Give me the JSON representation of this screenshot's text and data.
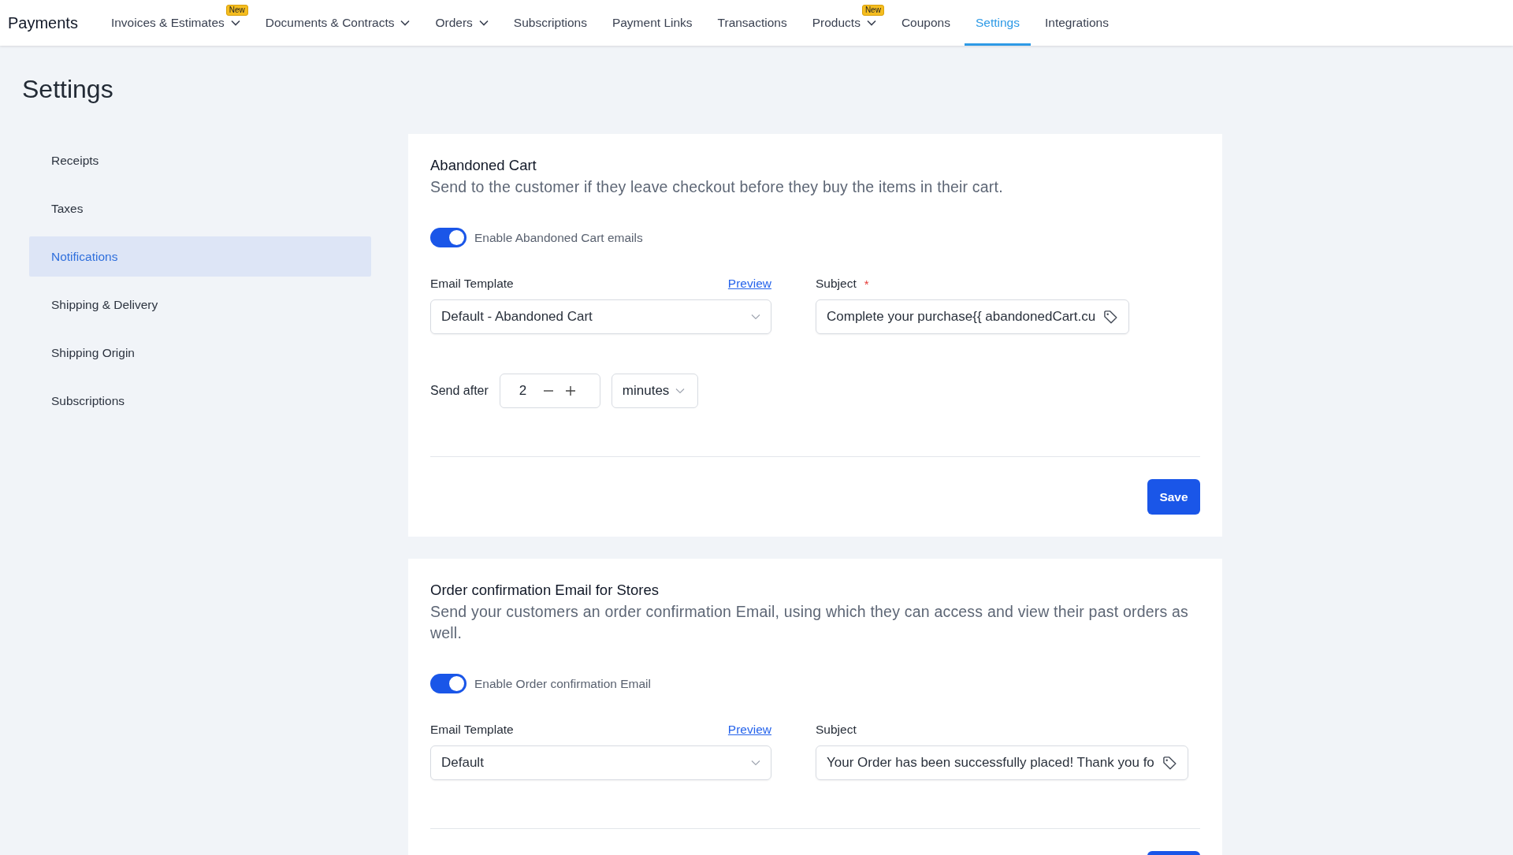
{
  "app_title": "Payments",
  "nav": [
    {
      "label": "Invoices & Estimates",
      "selected": false,
      "dropdown": true,
      "badge": "New"
    },
    {
      "label": "Documents & Contracts",
      "selected": false,
      "dropdown": true
    },
    {
      "label": "Orders",
      "selected": false,
      "dropdown": true
    },
    {
      "label": "Subscriptions",
      "selected": false,
      "dropdown": false
    },
    {
      "label": "Payment Links",
      "selected": false,
      "dropdown": false
    },
    {
      "label": "Transactions",
      "selected": false,
      "dropdown": false
    },
    {
      "label": "Products",
      "selected": false,
      "dropdown": true,
      "badge": "New"
    },
    {
      "label": "Coupons",
      "selected": false,
      "dropdown": false
    },
    {
      "label": "Settings",
      "selected": true,
      "dropdown": false
    },
    {
      "label": "Integrations",
      "selected": false,
      "dropdown": false
    }
  ],
  "page_title": "Settings",
  "sidebar": {
    "items": [
      {
        "label": "Receipts",
        "selected": false
      },
      {
        "label": "Taxes",
        "selected": false
      },
      {
        "label": "Notifications",
        "selected": true
      },
      {
        "label": "Shipping & Delivery",
        "selected": false
      },
      {
        "label": "Shipping Origin",
        "selected": false
      },
      {
        "label": "Subscriptions",
        "selected": false
      }
    ]
  },
  "cards": [
    {
      "title": "Abandoned Cart",
      "description": "Send to the customer if they leave checkout before they buy the items in their cart.",
      "toggle": {
        "label": "Enable Abandoned Cart emails",
        "on": true
      },
      "template": {
        "label": "Email Template",
        "preview": "Preview",
        "value": "Default - Abandoned Cart"
      },
      "subject": {
        "label": "Subject",
        "required_mark": "*",
        "value": "Complete your purchase{{ abandonedCart.cu"
      },
      "send_after": {
        "label": "Send after",
        "value": "2",
        "unit": "minutes"
      },
      "save": "Save"
    },
    {
      "title": "Order confirmation Email for Stores",
      "description": "Send your customers an order confirmation Email, using which they can access and view their past orders as well.",
      "toggle": {
        "label": "Enable Order confirmation Email",
        "on": true
      },
      "template": {
        "label": "Email Template",
        "preview": "Preview",
        "value": "Default"
      },
      "subject": {
        "label": "Subject",
        "value": "Your Order has been successfully placed! Thank you fo"
      }
    }
  ]
}
